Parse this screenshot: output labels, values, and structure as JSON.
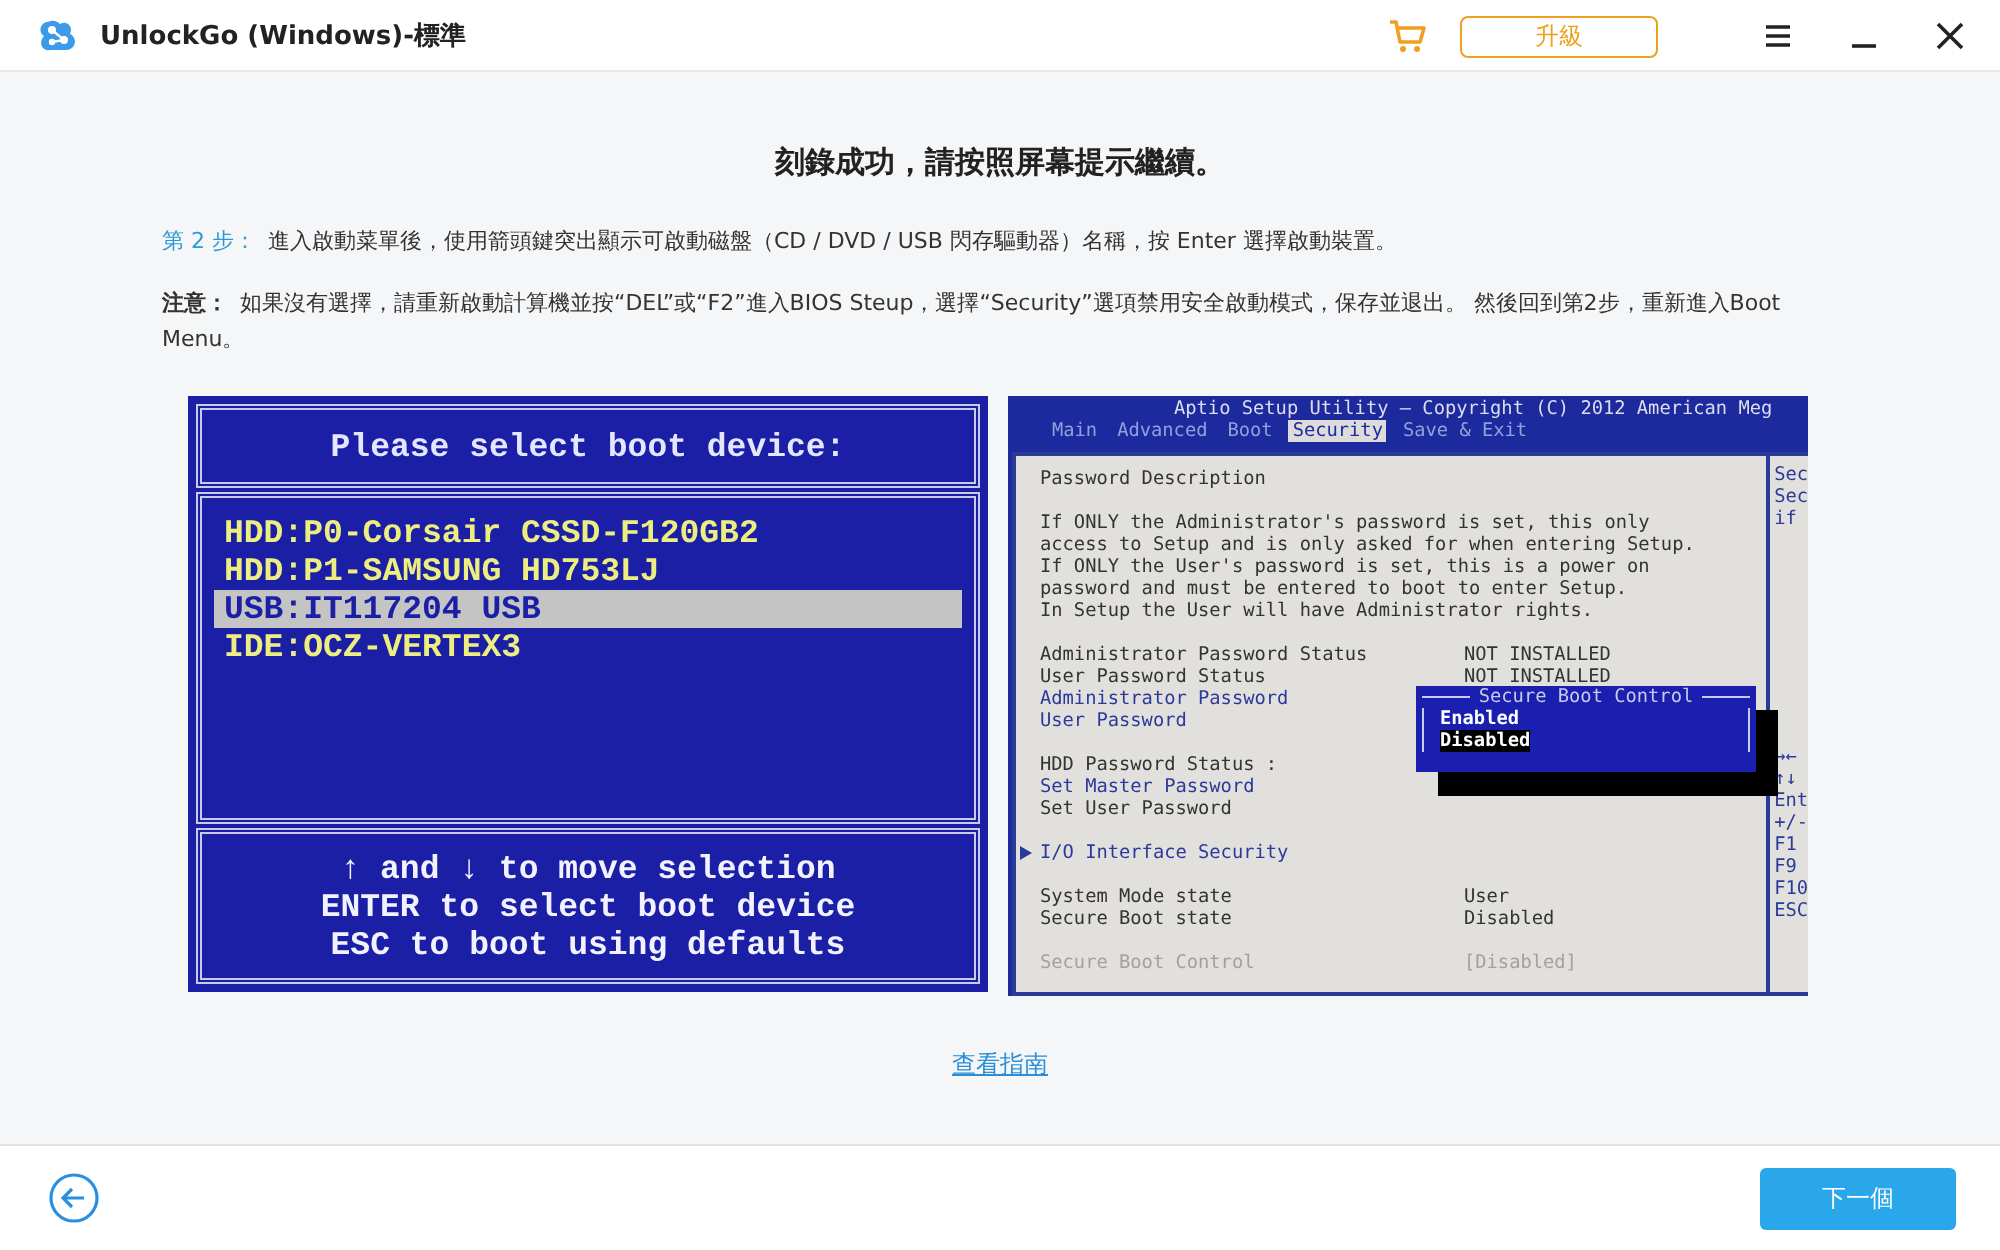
{
  "window": {
    "title": "UnlockGo (Windows)-標準",
    "upgrade_button": "升級"
  },
  "heading": "刻錄成功，請按照屏幕提示繼續。",
  "step": {
    "label": "第 2 步：",
    "text": "進入啟動菜單後，使用箭頭鍵突出顯示可啟動磁盤（CD / DVD / USB 閃存驅動器）名稱，按 Enter 選擇啟動裝置。"
  },
  "note": {
    "label": "注意：",
    "text": "如果沒有選擇，請重新啟動計算機並按“DEL”或“F2”進入BIOS Steup，選擇“Security”選項禁用安全啟動模式，保存並退出。 然後回到第2步，重新進入Boot Menu。"
  },
  "boot_menu": {
    "title": "Please select boot device:",
    "devices": [
      {
        "label": "HDD:P0-Corsair CSSD-F120GB2",
        "selected": false
      },
      {
        "label": "HDD:P1-SAMSUNG HD753LJ",
        "selected": false
      },
      {
        "label": "USB:IT117204 USB",
        "selected": true
      },
      {
        "label": "IDE:OCZ-VERTEX3",
        "selected": false
      }
    ],
    "hints": [
      "↑ and ↓ to move selection",
      "ENTER to select boot device",
      "ESC to boot using defaults"
    ]
  },
  "bios_setup": {
    "header": "Aptio Setup Utility – Copyright (C) 2012 American Meg",
    "tabs": [
      {
        "label": "Main",
        "selected": false
      },
      {
        "label": "Advanced",
        "selected": false
      },
      {
        "label": "Boot",
        "selected": false
      },
      {
        "label": "Security",
        "selected": true
      },
      {
        "label": "Save & Exit",
        "selected": false
      }
    ],
    "description_title": "Password Description",
    "description": [
      "If ONLY the Administrator's password is set, this only",
      "access to Setup and is only asked for when entering Setup.",
      "If ONLY the User's password is set, this is a power on",
      "password and must be entered to boot to enter Setup.",
      "In Setup the User will have Administrator rights."
    ],
    "groups": [
      [
        {
          "kind": "static",
          "label": "Administrator Password Status",
          "value": "NOT INSTALLED"
        },
        {
          "kind": "static",
          "label": "User Password Status",
          "value": "NOT INSTALLED"
        },
        {
          "kind": "link",
          "label": "Administrator Password"
        },
        {
          "kind": "link",
          "label": "User Password"
        }
      ],
      [
        {
          "kind": "static",
          "label": "HDD Password Status  :"
        },
        {
          "kind": "link",
          "label": "Set Master Password"
        },
        {
          "kind": "static",
          "label": "Set User Password"
        }
      ],
      [
        {
          "kind": "submenu",
          "label": "I/O Interface Security"
        }
      ],
      [
        {
          "kind": "static",
          "label": "System Mode state",
          "value": "User"
        },
        {
          "kind": "static",
          "label": "Secure Boot state",
          "value": "Disabled"
        }
      ],
      [
        {
          "kind": "disabled",
          "label": "Secure Boot Control",
          "value": "[Disabled]"
        }
      ]
    ],
    "popup": {
      "title": "Secure Boot Control",
      "options": [
        {
          "label": "Enabled",
          "selected": false
        },
        {
          "label": "Disabled",
          "selected": true
        }
      ]
    },
    "side_help_top": [
      "Sec",
      "Sec",
      "if"
    ],
    "side_help_keys": [
      "→←",
      "↑↓",
      "Ent",
      "+/-",
      "F1",
      "F9",
      "F10",
      "ESC"
    ]
  },
  "guide_link": "查看指南",
  "next_button": "下一個"
}
